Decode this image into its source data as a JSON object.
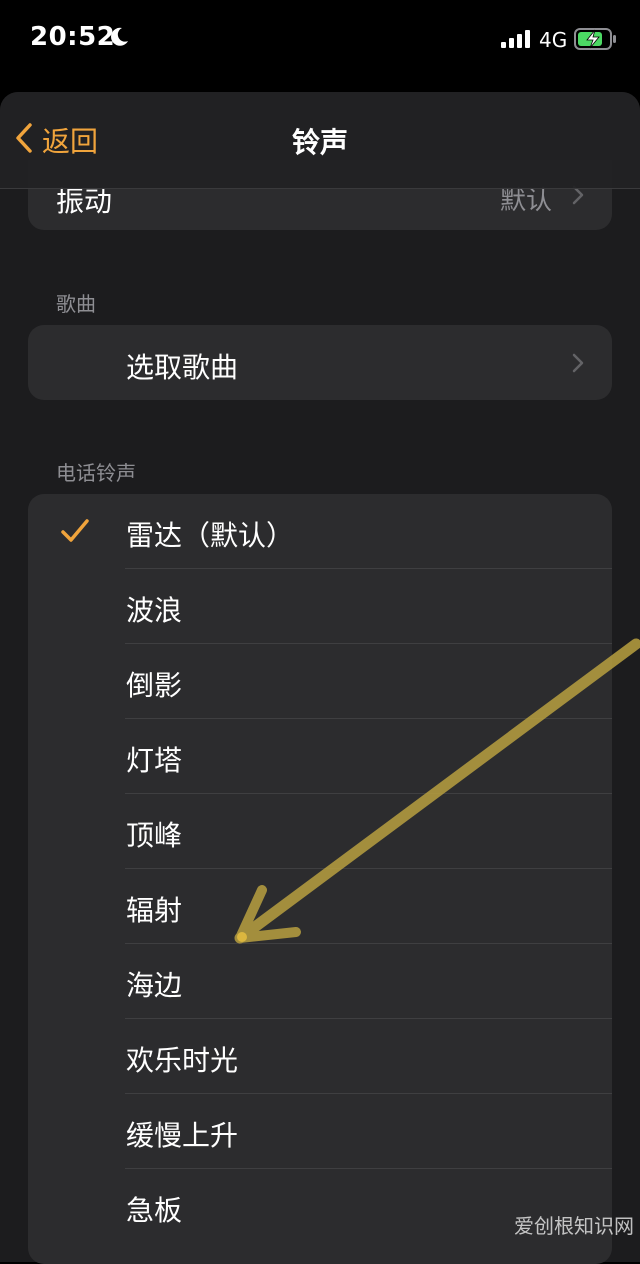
{
  "status_bar": {
    "time": "20:52",
    "network": "4G"
  },
  "nav": {
    "back_label": "返回",
    "title": "铃声"
  },
  "vibration": {
    "label": "振动",
    "value": "默认"
  },
  "songs": {
    "section_header": "歌曲",
    "pick_label": "选取歌曲"
  },
  "ringtones": {
    "section_header": "电话铃声",
    "items": [
      {
        "label": "雷达（默认）",
        "selected": true
      },
      {
        "label": "波浪",
        "selected": false
      },
      {
        "label": "倒影",
        "selected": false
      },
      {
        "label": "灯塔",
        "selected": false
      },
      {
        "label": "顶峰",
        "selected": false
      },
      {
        "label": "辐射",
        "selected": false
      },
      {
        "label": "海边",
        "selected": false
      },
      {
        "label": "欢乐时光",
        "selected": false
      },
      {
        "label": "缓慢上升",
        "selected": false
      },
      {
        "label": "急板",
        "selected": false
      }
    ]
  },
  "watermark": "爱创根知识网",
  "colors": {
    "accent": "#f0a43c",
    "background": "#1c1c1e",
    "cell": "#2c2c2e",
    "secondary_text": "#8e8e93",
    "annotation_arrow": "#b8a040"
  },
  "icons": {
    "moon": "moon-icon",
    "signal": "cellular-signal-icon",
    "battery": "battery-charging-icon",
    "back": "chevron-left-icon",
    "disclosure": "chevron-right-icon",
    "check": "checkmark-icon"
  }
}
